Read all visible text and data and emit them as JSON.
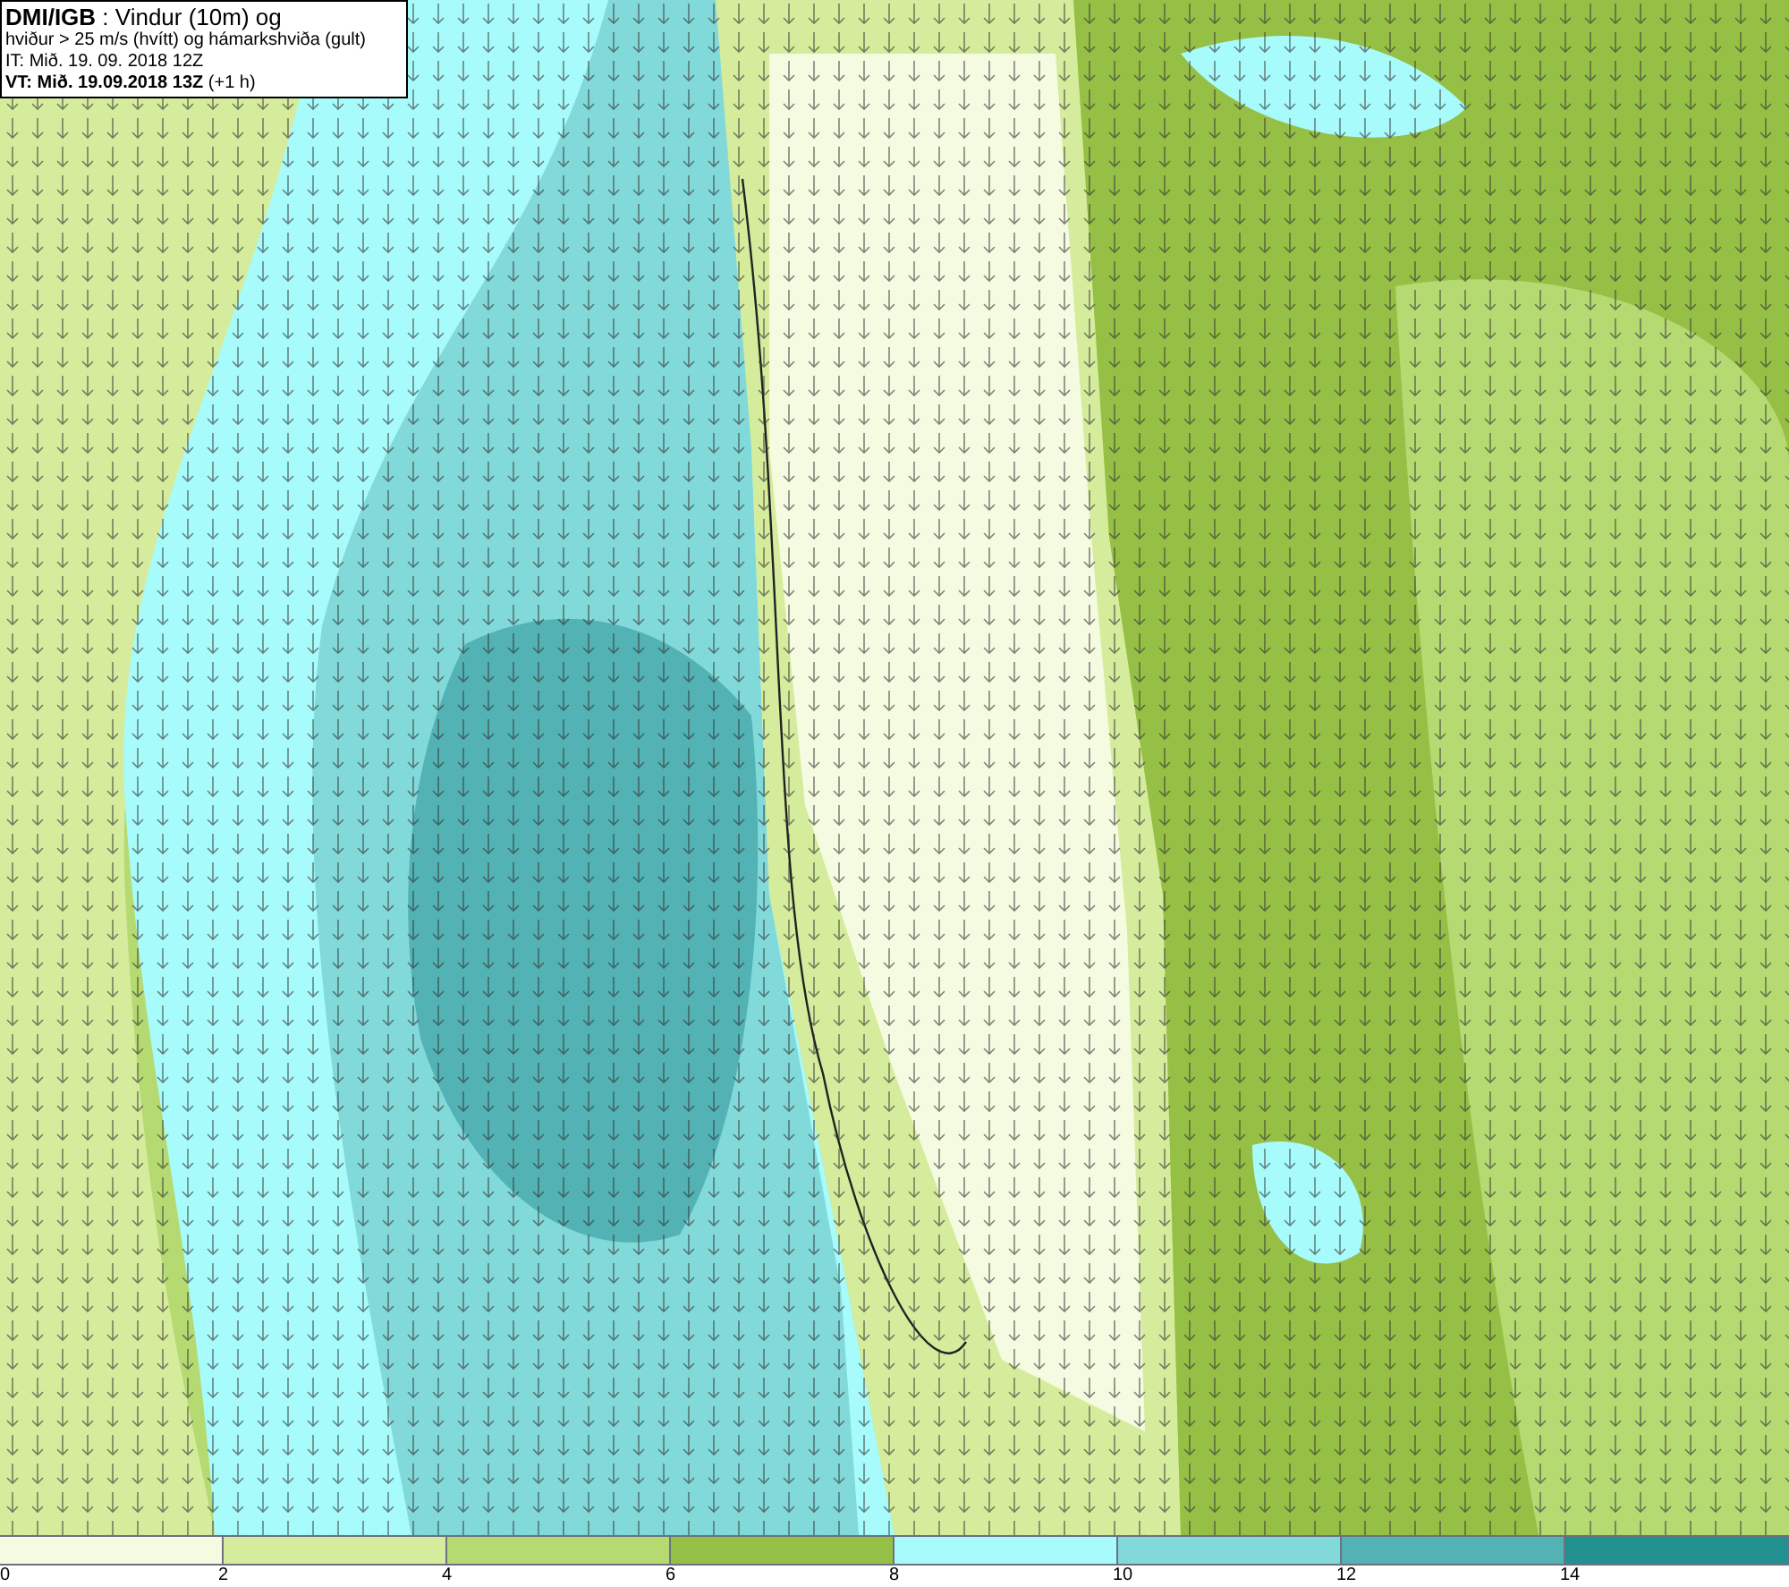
{
  "info_box": {
    "lines": [
      "**DMI/IGB** : Vindur (10m) og",
      "hviður > 25 m/s (hvítt) og hámarkshviða (gult)",
      "IT: Mið. 19. 09. 2018 12Z",
      "**VT: Mið. 19.09.2018 13Z** (+1 h)"
    ]
  },
  "legend": {
    "segments": [
      {
        "color": "#f5fbe0"
      },
      {
        "color": "#d5ec9c"
      },
      {
        "color": "#b5da72"
      },
      {
        "color": "#96bf46"
      },
      {
        "color": "#a8fbfb"
      },
      {
        "color": "#82d9da"
      },
      {
        "color": "#52b2b4"
      },
      {
        "color": "#22908f"
      }
    ],
    "ticks": [
      "0",
      "2",
      "4",
      "6",
      "8",
      "10",
      "12",
      "14"
    ]
  }
}
